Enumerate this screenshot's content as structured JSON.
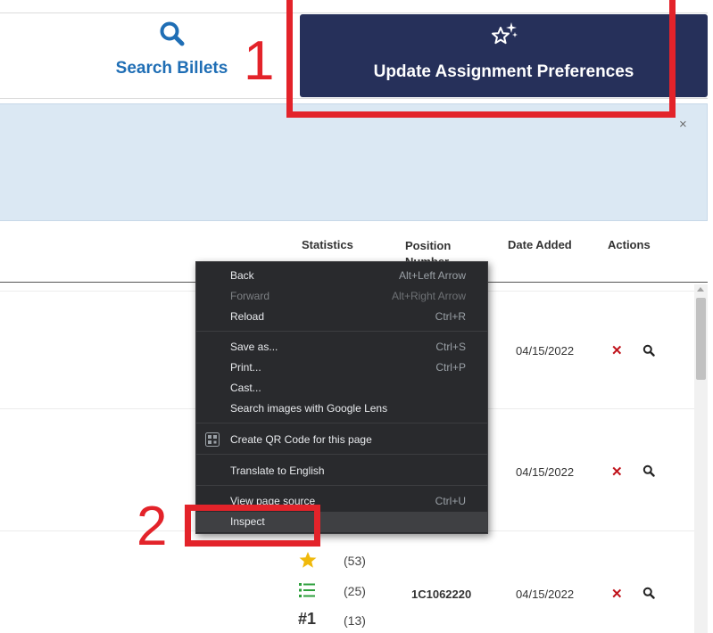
{
  "header": {
    "search_billets": {
      "label": "Search Billets",
      "icon": "search-icon"
    },
    "update_preferences": {
      "label": "Update Assignment Preferences",
      "icon": "sparkle-star-icon"
    }
  },
  "alert": {
    "close_symbol": "×"
  },
  "table": {
    "columns": [
      "Statistics",
      "Position Number",
      "Date Added",
      "Actions"
    ],
    "rows": [
      {
        "date_added": "04/15/2022",
        "position_number": "",
        "statistics": []
      },
      {
        "date_added": "04/15/2022",
        "position_number": "",
        "statistics": []
      },
      {
        "date_added": "04/15/2022",
        "position_number": "1C1062220",
        "statistics": [
          {
            "icon": "star-icon",
            "count": "(53)"
          },
          {
            "icon": "list-icon",
            "count": "(25)"
          },
          {
            "icon": "rank-number-icon",
            "label": "#1",
            "count": "(13)"
          }
        ]
      }
    ],
    "action_remove_symbol": "✕",
    "action_view_icon": "search-icon"
  },
  "context_menu": {
    "items": [
      {
        "label": "Back",
        "shortcut": "Alt+Left Arrow",
        "enabled": true
      },
      {
        "label": "Forward",
        "shortcut": "Alt+Right Arrow",
        "enabled": false
      },
      {
        "label": "Reload",
        "shortcut": "Ctrl+R",
        "enabled": true
      },
      {
        "label": "Save as...",
        "shortcut": "Ctrl+S",
        "enabled": true
      },
      {
        "label": "Print...",
        "shortcut": "Ctrl+P",
        "enabled": true
      },
      {
        "label": "Cast...",
        "shortcut": "",
        "enabled": true
      },
      {
        "label": "Search images with Google Lens",
        "shortcut": "",
        "enabled": true
      },
      {
        "label": "Create QR Code for this page",
        "shortcut": "",
        "enabled": true,
        "icon": "qr-code-icon"
      },
      {
        "label": "Translate to English",
        "shortcut": "",
        "enabled": true
      },
      {
        "label": "View page source",
        "shortcut": "Ctrl+U",
        "enabled": true
      },
      {
        "label": "Inspect",
        "shortcut": "",
        "enabled": true,
        "highlighted": true
      }
    ]
  },
  "annotations": {
    "step1": "1",
    "step2": "2",
    "color": "#e3232a"
  },
  "colors": {
    "primary_button": "#26305a",
    "link": "#1f6eb5",
    "alert_bg": "#dbe8f3",
    "remove": "#c0131b"
  }
}
